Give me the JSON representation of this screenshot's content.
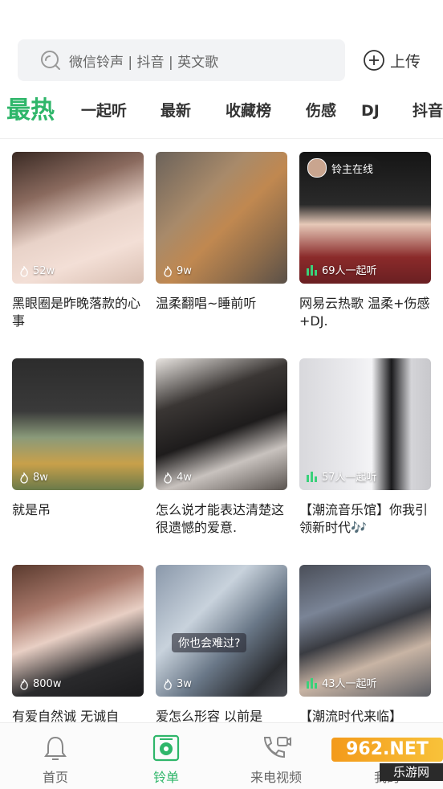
{
  "search": {
    "placeholder": "微信铃声 | 抖音 | 英文歌",
    "icon": "search-icon"
  },
  "upload": {
    "label": "上传",
    "icon": "plus-circle-icon"
  },
  "tabs": [
    {
      "label": "最热",
      "active": true
    },
    {
      "label": "一起听"
    },
    {
      "label": "最新"
    },
    {
      "label": "收藏榜"
    },
    {
      "label": "伤感"
    },
    {
      "label": "DJ"
    },
    {
      "label": "抖音"
    }
  ],
  "cards": [
    {
      "title": "黑眼圈是昨晚落款的心事",
      "stat": "52w",
      "stat_icon": "flame-icon"
    },
    {
      "title": "温柔翻唱~睡前听",
      "stat": "9w",
      "stat_icon": "flame-icon"
    },
    {
      "title": "网易云热歌 温柔+伤感 +DJ.",
      "stat": "69人一起听",
      "stat_icon": "bars-icon",
      "badge": "铃主在线"
    },
    {
      "title": "就是吊",
      "stat": "8w",
      "stat_icon": "flame-icon"
    },
    {
      "title": "怎么说才能表达清楚这很遗憾的爱意.",
      "stat": "4w",
      "stat_icon": "flame-icon"
    },
    {
      "title": "【潮流音乐馆】你我引领新时代🎶",
      "stat": "57人一起听",
      "stat_icon": "bars-icon"
    },
    {
      "title": "有爱自然诚 无诚自",
      "stat": "800w",
      "stat_icon": "flame-icon"
    },
    {
      "title": "爱怎么形容 以前是",
      "stat": "3w",
      "stat_icon": "flame-icon",
      "overlay": "你也会难过?"
    },
    {
      "title": "【潮流时代来临】",
      "stat": "43人一起听",
      "stat_icon": "bars-icon"
    }
  ],
  "bottom_nav": [
    {
      "label": "首页",
      "icon": "bell-icon"
    },
    {
      "label": "铃单",
      "icon": "disc-icon",
      "active": true
    },
    {
      "label": "来电视频",
      "icon": "phone-video-icon"
    },
    {
      "label": "我的",
      "icon": "user-icon"
    }
  ],
  "watermark": {
    "top": "962.NET",
    "bottom": "乐游网"
  },
  "colors": {
    "accent": "#2fb66a",
    "text": "#222222",
    "muted": "#666666"
  }
}
